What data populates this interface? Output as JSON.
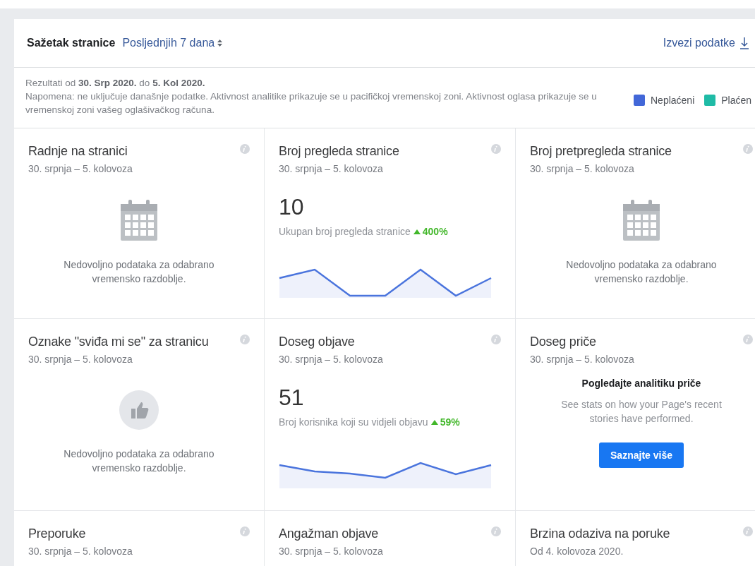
{
  "header": {
    "title": "Sažetak stranice",
    "period": "Posljednjih 7 dana",
    "export": "Izvezi podatke"
  },
  "notice": {
    "results": "Rezultati od **30. Srp 2020.** do **5. Kol 2020.**",
    "note": "Napomena: ne uključuje današnje podatke. Aktivnost analitike prikazuje se u pacifičkoj vremenskoj zoni. Aktivnost oglasa prikazuje se u vremenskoj zoni vašeg oglašivačkog računa."
  },
  "legend": [
    {
      "label": "Neplaćeni",
      "color": "#4267d8"
    },
    {
      "label": "Plaćen",
      "color": "#1fbba6"
    }
  ],
  "cards": [
    {
      "kind": "empty",
      "title": "Radnje na stranici",
      "dates": "30. srpnja – 5. kolovoza",
      "message": "Nedovoljno podataka za odabrano vremensko razdoblje."
    },
    {
      "kind": "metric",
      "title": "Broj pregleda stranice",
      "dates": "30. srpnja – 5. kolovoza",
      "value": "10",
      "caption": "Ukupan broj pregleda stranice",
      "change": "400%"
    },
    {
      "kind": "empty",
      "title": "Broj pretpregleda stranice",
      "dates": "30. srpnja – 5. kolovoza",
      "message": "Nedovoljno podataka za odabrano vremensko razdoblje."
    },
    {
      "kind": "empty",
      "title": "Oznake \"sviđa mi se\" za stranicu",
      "dates": "30. srpnja – 5. kolovoza",
      "message": "Nedovoljno podataka za odabrano vremensko razdoblje."
    },
    {
      "kind": "metric",
      "title": "Doseg objave",
      "dates": "30. srpnja – 5. kolovoza",
      "value": "51",
      "caption": "Broj korisnika koji su vidjeli objavu",
      "change": "59%"
    },
    {
      "kind": "promo",
      "title": "Doseg priče",
      "dates": "30. srpnja – 5. kolovoza",
      "heading": "Pogledajte analitiku priče",
      "text": "See stats on how your Page's recent stories have performed.",
      "button": "Saznajte više"
    },
    {
      "kind": "header",
      "title": "Preporuke",
      "dates": "30. srpnja – 5. kolovoza"
    },
    {
      "kind": "header",
      "title": "Angažman objave",
      "dates": "30. srpnja – 5. kolovoza"
    },
    {
      "kind": "header",
      "title": "Brzina odaziva na poruke",
      "dates": "Od 4. kolovoza 2020."
    }
  ]
}
